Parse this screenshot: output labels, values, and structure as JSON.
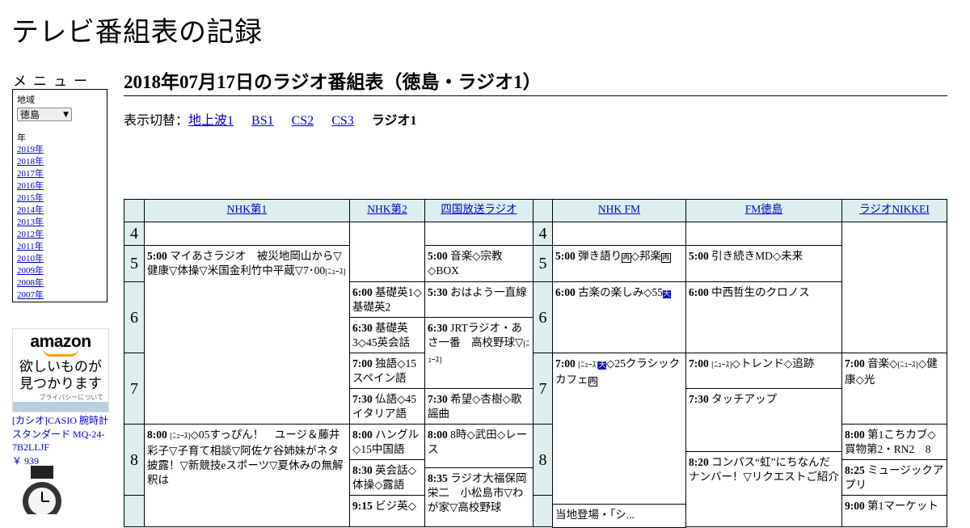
{
  "site_title": "テレビ番組表の記録",
  "menu": {
    "title": "メニュー",
    "region_label": "地域",
    "region_value": "徳島",
    "year_label": "年",
    "years": [
      "2019年",
      "2018年",
      "2017年",
      "2016年",
      "2015年",
      "2014年",
      "2013年",
      "2012年",
      "2011年",
      "2010年",
      "2009年",
      "2008年",
      "2007年"
    ]
  },
  "ad": {
    "logo": "amazon",
    "message_line1": "欲しいものが",
    "message_line2": "見つかります",
    "privacy": "プライバシーについて",
    "product_name": "[カシオ]CASIO 腕時計 スタンダード MQ-24-7B2LLJF",
    "product_price": "￥ 939"
  },
  "page_title": "2018年07月17日のラジオ番組表（徳島・ラジオ1）",
  "switcher": {
    "label": "表示切替：",
    "links": [
      "地上波1",
      "BS1",
      "CS2",
      "CS3"
    ],
    "current": "ラジオ1"
  },
  "channels": [
    "NHK第1",
    "NHK第2",
    "四国放送ラジオ",
    "NHK FM",
    "FM徳島",
    "ラジオNIKKEI"
  ],
  "hours": [
    "4",
    "5",
    "6",
    "7",
    "8"
  ],
  "programs": {
    "nhk1_500": {
      "time": "5:00",
      "title": "マイあさラジオ　被災地岡山から▽健康▽体操▽米国金利竹中平蔵▽7･00",
      "tag": "[ﾆｭｰｽ]"
    },
    "nhk1_800": {
      "time": "8:00",
      "tag": "[ﾆｭｰｽ]",
      "title": "◇05すっぴん！　ユージ＆藤井彩子▽子育て相談▽阿佐ケ谷姉妹がネタ披露！▽新競技eスポーツ▽夏休みの無解釈は"
    },
    "nhk2_600": {
      "time": "6:00",
      "title": "基礎英1◇基礎英2"
    },
    "nhk2_630": {
      "time": "6:30",
      "title": "基礎英3◇45英会話"
    },
    "nhk2_700": {
      "time": "7:00",
      "title": "独語◇15スペイン語"
    },
    "nhk2_730": {
      "time": "7:30",
      "title": "仏語◇45イタリア語"
    },
    "nhk2_800": {
      "time": "8:00",
      "title": "ハングル◇15中国語"
    },
    "nhk2_830": {
      "time": "8:30",
      "title": "英会話◇体操◇露語"
    },
    "nhk2_915": {
      "time": "9:15",
      "title": "ビジ英◇"
    },
    "shikoku_500": {
      "time": "5:00",
      "title": "音楽◇宗教◇BOX"
    },
    "shikoku_530": {
      "time": "5:30",
      "title": "おはよう一直線"
    },
    "shikoku_630": {
      "time": "6:30",
      "title": "JRTラジオ・あさ一番　高校野球▽",
      "tag": "[ﾆｭｰｽ]"
    },
    "shikoku_730": {
      "time": "7:30",
      "title": "希望◇杏樹◇歌謡曲"
    },
    "shikoku_800": {
      "time": "8:00",
      "title": "8時◇武田◇レース"
    },
    "shikoku_835": {
      "time": "8:35",
      "title": "ラジオ大福保岡栄二　小松島市▽わが家▽高校野球"
    },
    "fm_500": {
      "time": "5:00",
      "title": "弾き語り",
      "b1": "再",
      "mid": "◇邦楽",
      "b2": "再"
    },
    "fm_600": {
      "time": "6:00",
      "title": "古楽の楽しみ◇55",
      "b1": "天"
    },
    "fm_700": {
      "time": "7:00",
      "tag": "[ﾆｭｰｽ]",
      "b1": "天",
      "title": "◇25クラシックカフェ",
      "b2": "再"
    },
    "fm_bottom": {
      "title": "当地登場・「シ..."
    },
    "fmt_500": {
      "time": "5:00",
      "title": "引き続きMD◇未来"
    },
    "fmt_600": {
      "time": "6:00",
      "title": "中西哲生のクロノス"
    },
    "fmt_700": {
      "time": "7:00",
      "tag": "[ﾆｭｰｽ]",
      "title": "◇トレンド◇追跡"
    },
    "fmt_730": {
      "time": "7:30",
      "title": "タッチアップ"
    },
    "fmt_820": {
      "time": "8:20",
      "title": "コンパス“虹”にちなんだナンバー！▽リクエストご紹介"
    },
    "nikkei_700": {
      "time": "7:00",
      "title": "音楽◇",
      "tag": "[ﾆｭｰｽ]",
      "title2": "◇健康◇光"
    },
    "nikkei_800": {
      "time": "8:00",
      "title": "第1こちカブ◇買物第2・RN2　8"
    },
    "nikkei_825": {
      "time": "8:25",
      "title": "ミュージックアプリ"
    },
    "nikkei_900": {
      "time": "9:00",
      "title": "第1マーケット"
    }
  }
}
